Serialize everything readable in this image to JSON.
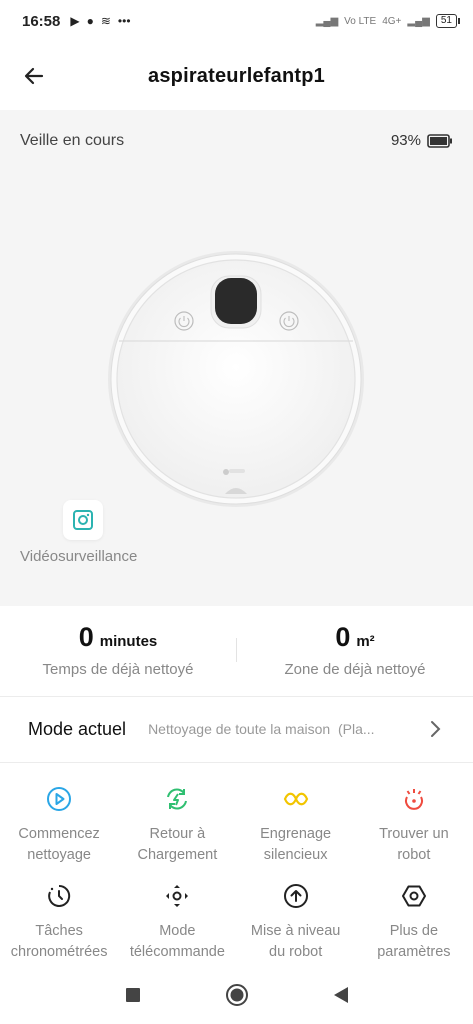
{
  "status_bar": {
    "time": "16:58",
    "carrier_text": "Vo LTE",
    "network_text": "4G+",
    "battery": "51"
  },
  "header": {
    "title": "aspirateurlefantp1"
  },
  "device": {
    "state": "Veille en cours",
    "battery_pct": "93%",
    "video_label": "Vidéosurveillance"
  },
  "stats": [
    {
      "value": "0",
      "unit": "minutes",
      "label": "Temps de déjà nettoyé"
    },
    {
      "value": "0",
      "unit": "m²",
      "label": "Zone de déjà nettoyé"
    }
  ],
  "mode": {
    "label": "Mode actuel",
    "value": "Nettoyage de toute la maison  (Pla..."
  },
  "actions": [
    {
      "label": "Commencez\nnettoyage",
      "icon": "play-circle-icon",
      "color": "#2aa6e6"
    },
    {
      "label": "Retour à\nChargement",
      "icon": "recharge-icon",
      "color": "#2fbf71"
    },
    {
      "label": "Engrenage\nsilencieux",
      "icon": "quiet-gear-icon",
      "color": "#f2c500"
    },
    {
      "label": "Trouver un\nrobot",
      "icon": "find-robot-icon",
      "color": "#ef4b3f"
    },
    {
      "label": "Tâches\nchronométrées",
      "icon": "timer-icon",
      "color": "#222222"
    },
    {
      "label": "Mode\ntélécommande",
      "icon": "remote-control-icon",
      "color": "#222222"
    },
    {
      "label": "Mise à niveau\ndu robot",
      "icon": "upgrade-icon",
      "color": "#222222"
    },
    {
      "label": "Plus de\nparamètres",
      "icon": "settings-hex-icon",
      "color": "#222222"
    }
  ],
  "colors": {
    "hero_bg": "#f5f5f5",
    "accent_teal": "#2bb3b1"
  }
}
